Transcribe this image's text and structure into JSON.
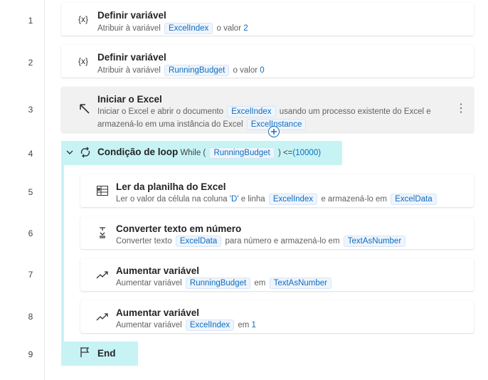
{
  "line_numbers": [
    "1",
    "2",
    "3",
    "4",
    "5",
    "6",
    "7",
    "8",
    "9"
  ],
  "steps": [
    {
      "title": "Definir variável",
      "desc": {
        "t1": "Atribuir à variável",
        "var": "ExcelIndex",
        "t2": "o valor",
        "val": "2"
      }
    },
    {
      "title": "Definir variável",
      "desc": {
        "t1": "Atribuir à variável",
        "var": "RunningBudget",
        "t2": "o valor",
        "val": "0"
      }
    },
    {
      "title": "Iniciar o Excel",
      "desc": {
        "t1": "Iniciar o Excel e abrir o documento",
        "var1": "ExcelIndex",
        "t2": "usando um processo existente do Excel e",
        "t3": "armazená-lo em uma instância do Excel",
        "var2": "ExcelInstance"
      }
    },
    {
      "title": "Condição de loop",
      "while_prefix": "While (",
      "var": "RunningBudget",
      "op": ") <=",
      "val": "(10000)"
    },
    {
      "title": "Ler da planilha do Excel",
      "desc": {
        "t1": "Ler o valor da célula na coluna",
        "col": "'D'",
        "t2": "e linha",
        "var1": "ExcelIndex",
        "t3": "e armazená-lo em",
        "var2": "ExcelData"
      }
    },
    {
      "title": "Converter texto em número",
      "desc": {
        "t1": "Converter texto",
        "var1": "ExcelData",
        "t2": "para número e armazená-lo em",
        "var2": "TextAsNumber"
      }
    },
    {
      "title": "Aumentar variável",
      "desc": {
        "t1": "Aumentar variável",
        "var1": "RunningBudget",
        "t2": "em",
        "var2": "TextAsNumber"
      }
    },
    {
      "title": "Aumentar variável",
      "desc": {
        "t1": "Aumentar variável",
        "var1": "ExcelIndex",
        "t2": "em",
        "val": "1"
      }
    },
    {
      "title": "End"
    }
  ],
  "icons": {
    "variable": "{x}",
    "launch_excel": "arrow-up-left-icon",
    "loop": "loop-icon",
    "read_excel": "excel-sheet-icon",
    "convert": "convert-icon",
    "increase": "trend-up-icon",
    "end": "flag-icon",
    "more": "⋮"
  },
  "colors": {
    "token_bg": "#eef5fd",
    "token_text": "#0f6cbd",
    "loop_highlight": "#c7f3f5",
    "selected_card": "#f1f1f1"
  }
}
